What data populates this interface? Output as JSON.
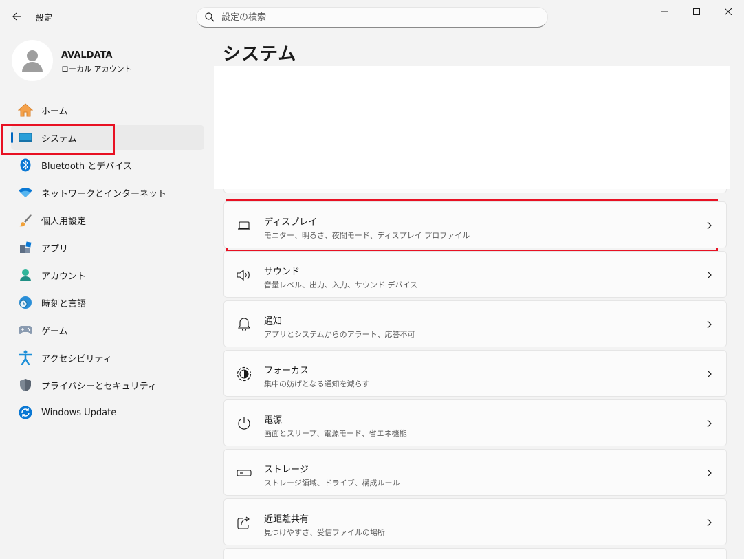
{
  "window": {
    "title": "設定",
    "controls": [
      "minimize",
      "maximize",
      "close"
    ]
  },
  "search": {
    "placeholder": "設定の検索"
  },
  "profile": {
    "name": "AVALDATA",
    "account_type": "ローカル アカウント"
  },
  "sidebar": {
    "items": [
      {
        "label": "ホーム",
        "icon": "home-icon"
      },
      {
        "label": "システム",
        "icon": "monitor-icon",
        "active": true
      },
      {
        "label": "Bluetooth とデバイス",
        "icon": "bluetooth-icon"
      },
      {
        "label": "ネットワークとインターネット",
        "icon": "wifi-icon"
      },
      {
        "label": "個人用設定",
        "icon": "brush-icon"
      },
      {
        "label": "アプリ",
        "icon": "apps-icon"
      },
      {
        "label": "アカウント",
        "icon": "account-icon"
      },
      {
        "label": "時刻と言語",
        "icon": "clock-globe-icon"
      },
      {
        "label": "ゲーム",
        "icon": "gamepad-icon"
      },
      {
        "label": "アクセシビリティ",
        "icon": "accessibility-icon"
      },
      {
        "label": "プライバシーとセキュリティ",
        "icon": "shield-icon"
      },
      {
        "label": "Windows Update",
        "icon": "update-icon"
      }
    ]
  },
  "main": {
    "title": "システム",
    "cards": [
      {
        "title": "ディスプレイ",
        "subtitle": "モニター、明るさ、夜間モード、ディスプレイ プロファイル",
        "icon": "laptop-icon"
      },
      {
        "title": "サウンド",
        "subtitle": "音量レベル、出力、入力、サウンド デバイス",
        "icon": "speaker-icon"
      },
      {
        "title": "通知",
        "subtitle": "アプリとシステムからのアラート、応答不可",
        "icon": "bell-icon"
      },
      {
        "title": "フォーカス",
        "subtitle": "集中の妨げとなる通知を減らす",
        "icon": "focus-icon"
      },
      {
        "title": "電源",
        "subtitle": "画面とスリープ、電源モード、省エネ機能",
        "icon": "power-icon"
      },
      {
        "title": "ストレージ",
        "subtitle": "ストレージ領域、ドライブ、構成ルール",
        "icon": "storage-icon"
      },
      {
        "title": "近距離共有",
        "subtitle": "見つけやすさ、受信ファイルの場所",
        "icon": "share-icon"
      }
    ]
  },
  "colors": {
    "accent": "#0067c0",
    "highlight_box": "#e81123",
    "background": "#f3f3f3",
    "card": "#fbfbfb"
  }
}
